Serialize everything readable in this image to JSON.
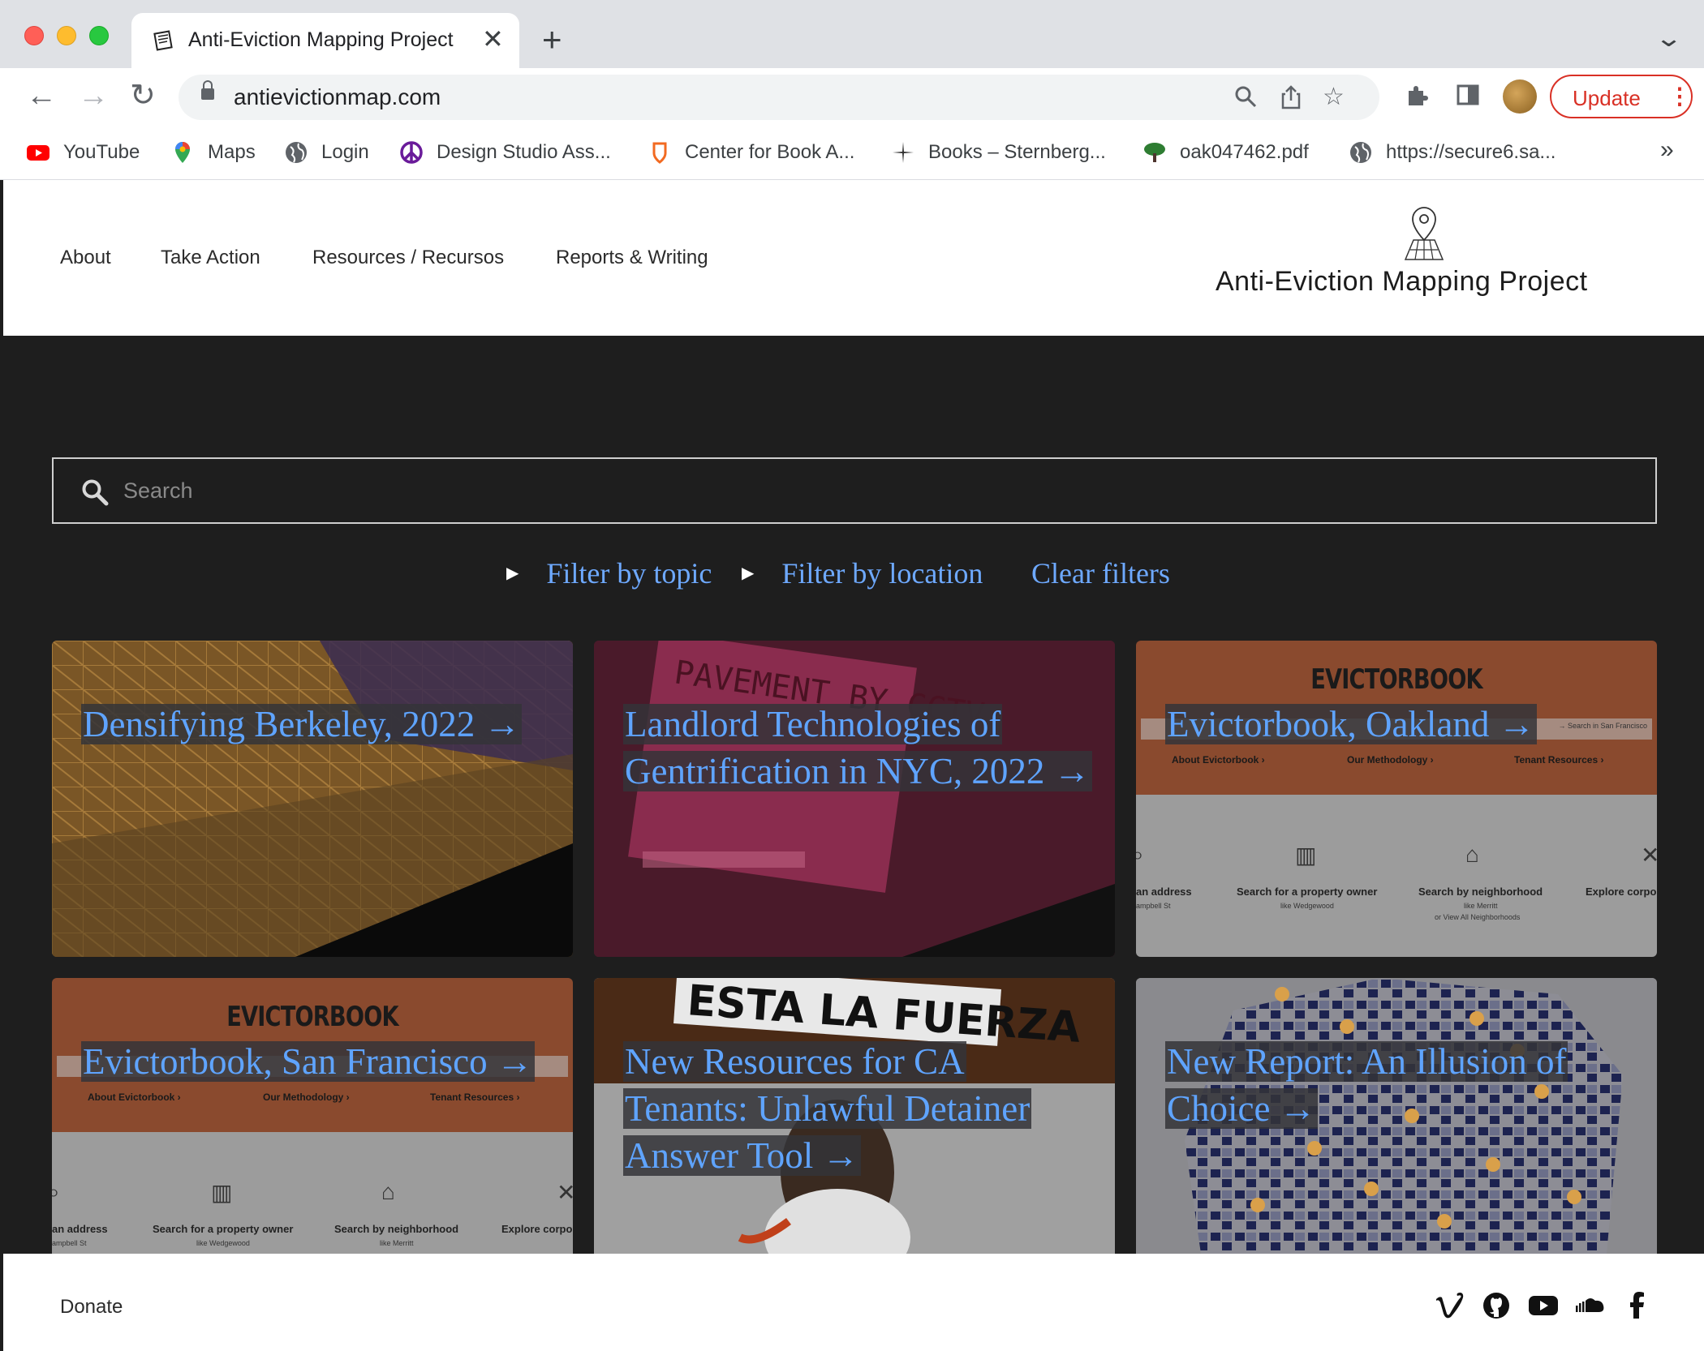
{
  "browser": {
    "tab_title": "Anti-Eviction Mapping Project",
    "url": "antievictionmap.com",
    "update_label": "Update",
    "bookmarks": [
      {
        "label": "YouTube",
        "icon": "youtube-icon"
      },
      {
        "label": "Maps",
        "icon": "maps-icon"
      },
      {
        "label": "Login",
        "icon": "globe-icon"
      },
      {
        "label": "Design Studio Ass...",
        "icon": "peace-icon"
      },
      {
        "label": "Center for Book A...",
        "icon": "shield-icon"
      },
      {
        "label": "Books – Sternberg...",
        "icon": "star-burst-icon"
      },
      {
        "label": "oak047462.pdf",
        "icon": "tree-icon"
      },
      {
        "label": "https://secure6.sa...",
        "icon": "globe-icon"
      }
    ],
    "more_bookmarks": "»"
  },
  "site": {
    "nav": [
      "About",
      "Take Action",
      "Resources / Recursos",
      "Reports & Writing"
    ],
    "logo_text": "Anti-Eviction Mapping Project",
    "search_placeholder": "Search",
    "filters": {
      "topic": "Filter by topic",
      "location": "Filter by location",
      "clear": "Clear filters"
    },
    "cards": [
      {
        "title": "Densifying Berkeley, 2022 →"
      },
      {
        "title": "Landlord Technologies of Gentrification in NYC, 2022 →"
      },
      {
        "title": "Evictorbook, Oakland →"
      },
      {
        "title": "Evictorbook, San Francisco →"
      },
      {
        "title": "New Resources for CA Tenants: Unlawful Detainer Answer Tool →"
      },
      {
        "title": "New Report: An Illusion of Choice →"
      }
    ],
    "evictorbook": {
      "brand": "EVICTORBOOK",
      "links": [
        "About Evictorbook ›",
        "Our Methodology ›",
        "Tenant Resources ›"
      ],
      "items": [
        "an address",
        "Search for a property owner",
        "Search by neighborhood",
        "Explore corpo"
      ],
      "subs": [
        "ampbell St",
        "like Wedgewood",
        "like Merritt",
        "or View All Neighborhoods"
      ],
      "search_hint": "→ Search in San Francisco"
    },
    "photo_texts": {
      "cctv_sign": "PAVEMENT BY CCTV",
      "protest_sign": "ESTA LA FUERZA"
    },
    "footer": {
      "donate": "Donate",
      "social": [
        "vimeo-icon",
        "github-icon",
        "youtube-icon",
        "soundcloud-icon",
        "facebook-icon"
      ]
    }
  },
  "colors": {
    "link_blue": "#5fa4ff",
    "dark_bg": "#1e1e1e",
    "update_red": "#d93025"
  }
}
